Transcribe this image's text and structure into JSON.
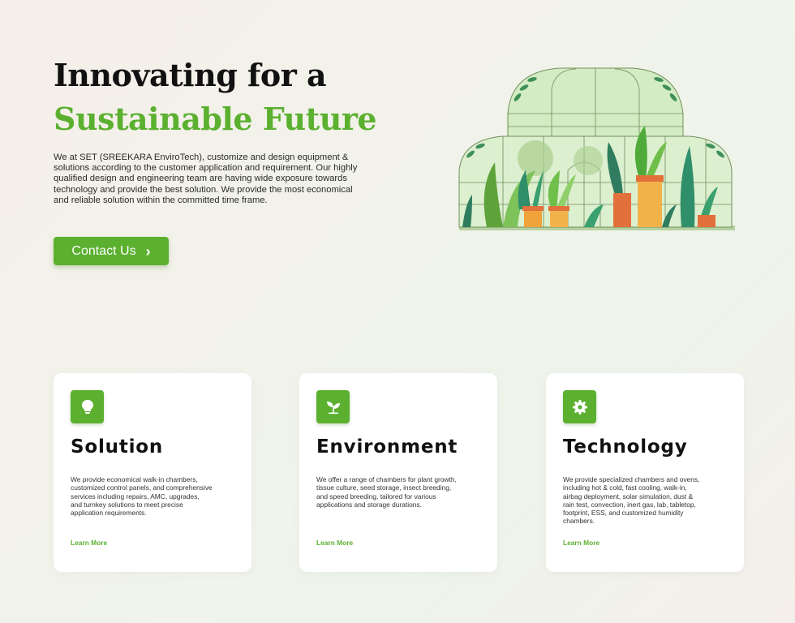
{
  "hero": {
    "title_line1": "Innovating for a",
    "title_line2": "Sustainable Future",
    "description": "We at SET (SREEKARA EnviroTech), customize and design equipment & solutions  according to the customer application and requirement. Our highly  qualified design and engineering team are having wide exposure towards  technology and provide the best solution. We provide the most economical  and reliable solution within the committed time frame.",
    "cta_label": "Contact Us",
    "cta_icon": "chevron-right-icon",
    "illustration": "greenhouse-illustration"
  },
  "colors": {
    "accent": "#5bb030",
    "heading": "#111111",
    "background": "#f3f1ea",
    "card": "#ffffff"
  },
  "cards": [
    {
      "icon": "lightbulb-icon",
      "title": "Solution",
      "description": "We provide economical walk-in chambers, customized control panels, and comprehensive services including repairs, AMC, upgrades, and turnkey solutions to meet precise application requirements.",
      "link": "Learn More"
    },
    {
      "icon": "sprout-icon",
      "title": "Environment",
      "description": "We offer a range of chambers for plant growth, tissue culture, seed storage, insect breeding, and speed breeding, tailored for various applications and storage durations.",
      "link": "Learn More"
    },
    {
      "icon": "gear-icon",
      "title": "Technology",
      "description": "We provide specialized chambers and ovens, including hot & cold, fast cooling, walk-in, airbag deployment, solar simulation, dust & rain test, convection, inert gas, lab, tabletop, footprint, ESS, and customized humidity chambers.",
      "link": "Learn More"
    }
  ]
}
